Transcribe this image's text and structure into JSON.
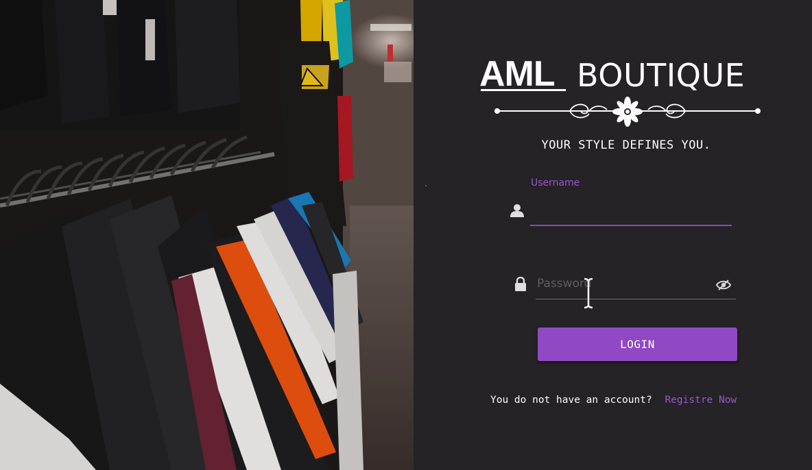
{
  "brand": {
    "name_bold": "AML",
    "name_light": "BOUTIQUE",
    "tagline": "YOUR STYLE DEFINES YOU."
  },
  "login_form": {
    "username_label": "Username",
    "username_value": "",
    "password_placeholder": "Password",
    "password_value": "",
    "login_button": "LOGIN"
  },
  "signup": {
    "prompt": "You do not have an account?",
    "link": "Registre Now"
  },
  "icons": {
    "username": "user-icon",
    "password": "lock-icon",
    "toggle_password": "eye-icon",
    "ornament": "flower-ornament-icon"
  },
  "colors": {
    "accent": "#9048c4",
    "label": "#9b55d6",
    "panel_background": "#252325",
    "text": "#ffffff"
  }
}
